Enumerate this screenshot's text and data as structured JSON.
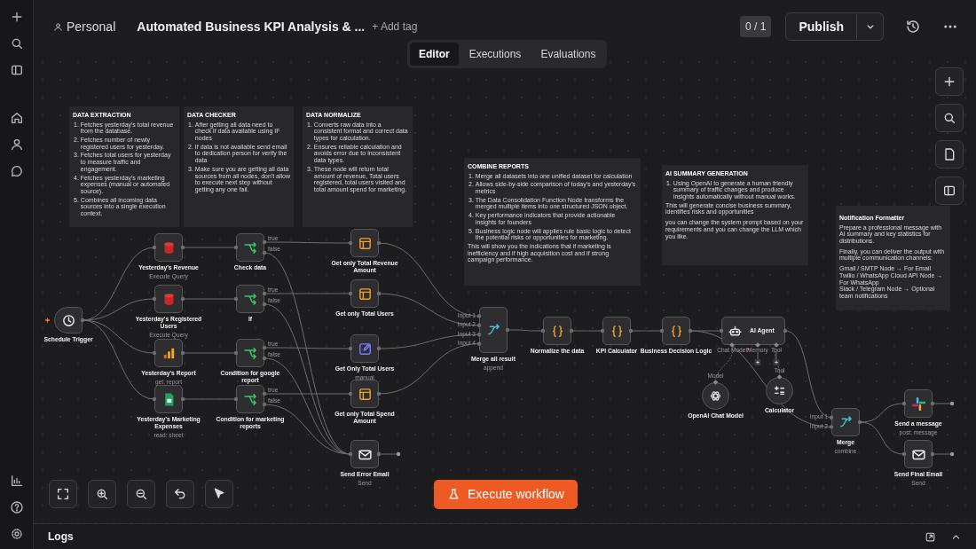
{
  "header": {
    "project": "Personal",
    "title": "Automated Business KPI Analysis & ...",
    "add_tag": "+ Add tag",
    "version_badge": "0 / 1",
    "publish": "Publish"
  },
  "tabs": [
    {
      "label": "Editor",
      "selected": true
    },
    {
      "label": "Executions",
      "selected": false
    },
    {
      "label": "Evaluations",
      "selected": false
    }
  ],
  "sticky_notes": [
    {
      "title": "DATA EXTRACTION",
      "items": [
        {
          "number": "1.",
          "text": "Fetches yesterday's total revenue from the database."
        },
        {
          "number": "2.",
          "text": "Fetches number of newly registered users for yesterday."
        },
        {
          "number": "3.",
          "text": "Fetches total users for yesterday to measure traffic and engagement."
        },
        {
          "number": "4.",
          "text": "Fetches yesterday's marketing expenses (manual or automated source)."
        },
        {
          "number": "5.",
          "text": "Combines all incoming data sources into a single execution context."
        }
      ]
    },
    {
      "title": "DATA CHECKER",
      "items": [
        {
          "number": "1.",
          "text": "After getting all data need to check if data available using IF nodes"
        },
        {
          "number": "2.",
          "text": "If data is not available send email to dedication person for verify the data"
        },
        {
          "number": "3.",
          "text": "Make sure you are getting all data sources from all nodes, don't allow to execute next step without getting any one fail."
        }
      ]
    },
    {
      "title": "DATA NORMALIZE",
      "items": [
        {
          "number": "1.",
          "text": "Converts raw data into a consistent format and correct data types for calculation."
        },
        {
          "number": "2.",
          "text": "Ensures reliable calculation and avoids error due to inconsistent data types."
        },
        {
          "number": "3.",
          "text": "These node will return total amount of revenue, Total users registered, total users visited and total amount spend for marketing."
        }
      ]
    },
    {
      "title": "COMBINE REPORTS",
      "items": [
        {
          "number": "1.",
          "text": "Merge all datasets into one unified dataset for calculation"
        },
        {
          "number": "2.",
          "text": "Allows side-by-side comparison of today's and yesterday's metrics"
        },
        {
          "number": "3.",
          "text": "The Data Consolidation Function Node transforms the merged multiple items into one structured JSON object."
        },
        {
          "number": "4.",
          "text": "Key performance indicators that provide actionable insights for founders"
        },
        {
          "number": "5.",
          "text": "Business logic node will applies rule basic logic to detect the potential risks or opportunities for marketing."
        }
      ],
      "paragraphs": [
        "This will show you the indications that if marketing is inefficiency and if high acquisition cost and if strong campaign performance."
      ]
    },
    {
      "title": "AI SUMMARY GENERATION",
      "items": [
        {
          "number": "1.",
          "text": "Using OpenAI to generate a human friendly summary of traffic changes and produce insights automatically without manual works."
        }
      ],
      "paragraphs": [
        "This will generate concise business summary, identifies risks and opportunities",
        "you can change the system prompt based on your requirements and you can change the LLM which you like."
      ]
    },
    {
      "title": "Notification Formatter",
      "paragraphs": [
        "Prepare a professional message with AI summary and key statistics for distributions.",
        "Finally, you can deliver the output with multiple communication channels:"
      ],
      "lines": [
        "Gmail / SMTP Node → For Email",
        "Twilio / WhatsApp Cloud API Node → For WhatsApp",
        "Slack / Telegram Node → Optional team notifications"
      ]
    }
  ],
  "nodes": [
    {
      "label": "Schedule Trigger",
      "kind": "schedule"
    },
    {
      "label": "Yesterday's Revenue",
      "subtitle": "Execute Query",
      "kind": "database"
    },
    {
      "label": "Yesterday's Registered Users",
      "subtitle": "Execute Query",
      "kind": "database"
    },
    {
      "label": "Yesterday's Report",
      "subtitle": "get: report",
      "kind": "analytics"
    },
    {
      "label": "Yesterday's Marketing Expenses",
      "subtitle": "read: sheet",
      "kind": "sheet"
    },
    {
      "label": "Check data",
      "kind": "if",
      "outputs": [
        "true",
        "false"
      ]
    },
    {
      "label": "If",
      "kind": "if",
      "outputs": [
        "true",
        "false"
      ]
    },
    {
      "label": "Condition for google report",
      "kind": "if",
      "outputs": [
        "true",
        "false"
      ]
    },
    {
      "label": "Condition for marketing reports",
      "kind": "if",
      "outputs": [
        "true",
        "false"
      ]
    },
    {
      "label": "Get only Total Revenue Amount",
      "kind": "set"
    },
    {
      "label": "Get only Total Users",
      "kind": "set"
    },
    {
      "label": "Get Only Total Users",
      "subtitle": "manual",
      "kind": "edit"
    },
    {
      "label": "Get only Total Spend Amount",
      "kind": "set"
    },
    {
      "label": "Send Error Email",
      "subtitle": "Send",
      "kind": "email"
    },
    {
      "label": "Merge all result",
      "subtitle": "append",
      "kind": "merge",
      "inputs": [
        "Input 1",
        "Input 2",
        "Input 3",
        "Input 4"
      ]
    },
    {
      "label": "Normalize the data",
      "kind": "code"
    },
    {
      "label": "KPI Calculator",
      "kind": "code"
    },
    {
      "label": "Business Decision Logic",
      "kind": "code"
    },
    {
      "label": "AI Agent",
      "kind": "agent",
      "ports": [
        {
          "label": "Chat Model",
          "required": true
        },
        {
          "label": "Memory",
          "required": false
        },
        {
          "label": "Tool",
          "required": false
        }
      ]
    },
    {
      "label": "OpenAI Chat Model",
      "kind": "openai",
      "port": "Model"
    },
    {
      "label": "Calculator",
      "kind": "calculator",
      "port": "Tool"
    },
    {
      "label": "Merge",
      "subtitle": "combine",
      "kind": "merge",
      "inputs": [
        "Input 1",
        "Input 2"
      ]
    },
    {
      "label": "Send a message",
      "subtitle": "post: message",
      "kind": "slack"
    },
    {
      "label": "Send Final Email",
      "subtitle": "Send",
      "kind": "email"
    }
  ],
  "execute_button": "Execute workflow",
  "logs": {
    "title": "Logs"
  }
}
